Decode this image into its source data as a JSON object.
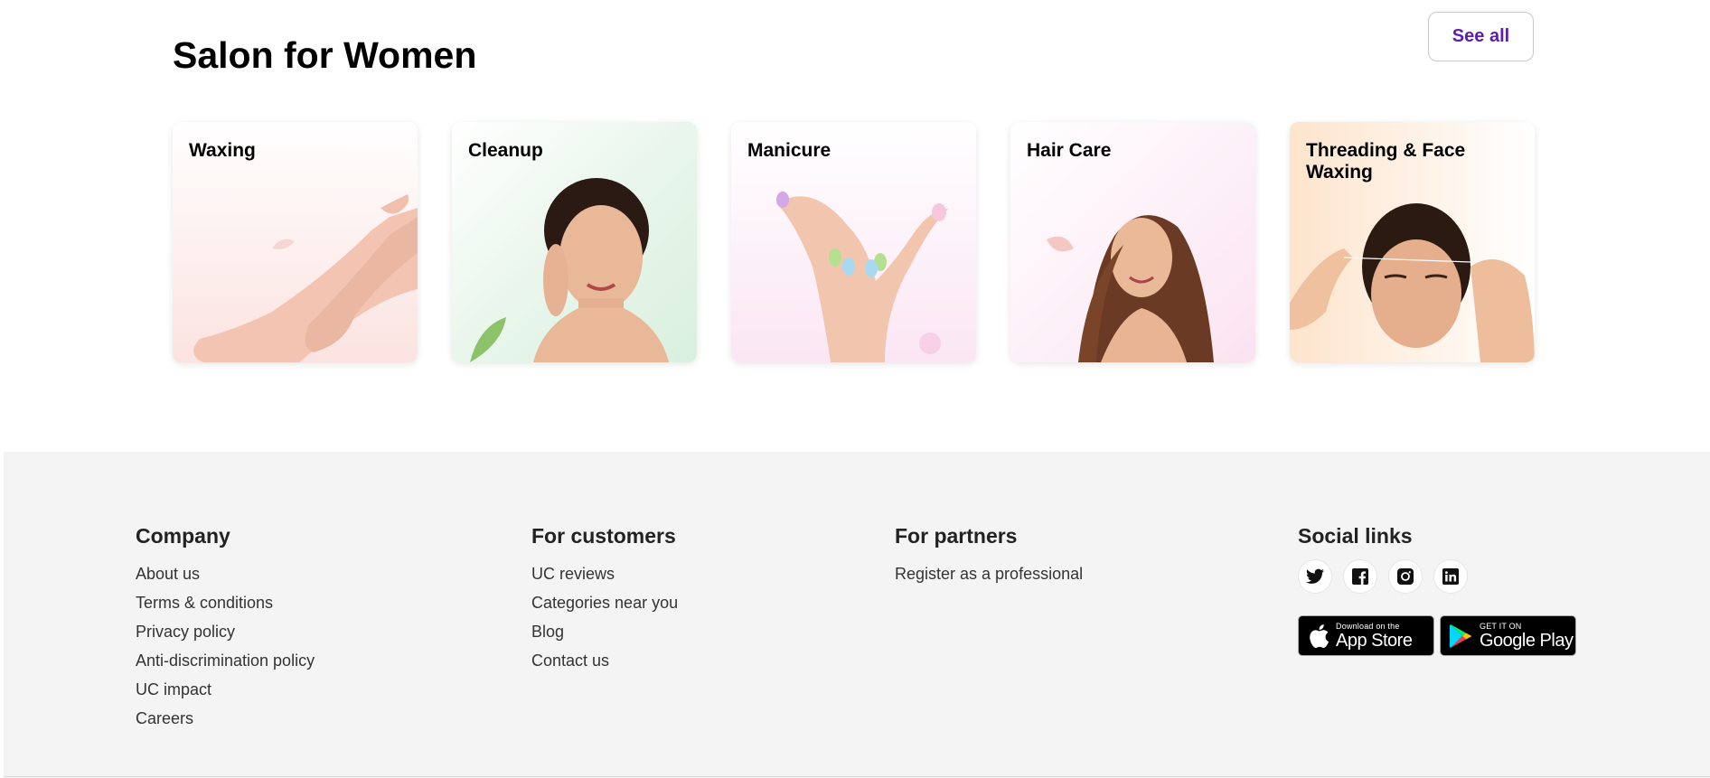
{
  "section": {
    "title": "Salon for Women",
    "see_all_label": "See all"
  },
  "cards": [
    {
      "label": "Waxing",
      "image": "leg-waxing-photo"
    },
    {
      "label": "Cleanup",
      "image": "woman-face-cleanup-photo"
    },
    {
      "label": "Manicure",
      "image": "manicured-hands-photo"
    },
    {
      "label": "Hair Care",
      "image": "woman-long-hair-photo"
    },
    {
      "label": "Threading & Face Waxing",
      "image": "eyebrow-threading-photo"
    }
  ],
  "footer": {
    "company": {
      "heading": "Company",
      "links": [
        "About us",
        "Terms & conditions",
        "Privacy policy",
        "Anti-discrimination policy",
        "UC impact",
        "Careers"
      ]
    },
    "customers": {
      "heading": "For customers",
      "links": [
        "UC reviews",
        "Categories near you",
        "Blog",
        "Contact us"
      ]
    },
    "partners": {
      "heading": "For partners",
      "links": [
        "Register as a professional"
      ]
    },
    "social": {
      "heading": "Social links",
      "icons": [
        "twitter-icon",
        "facebook-icon",
        "instagram-icon",
        "linkedin-icon"
      ],
      "app_store": {
        "small": "Download on the",
        "big": "App Store"
      },
      "google_play": {
        "small": "GET IT ON",
        "big": "Google Play"
      }
    }
  },
  "colors": {
    "accent": "#6e42e5",
    "footer_bg": "#f4f4f4"
  }
}
